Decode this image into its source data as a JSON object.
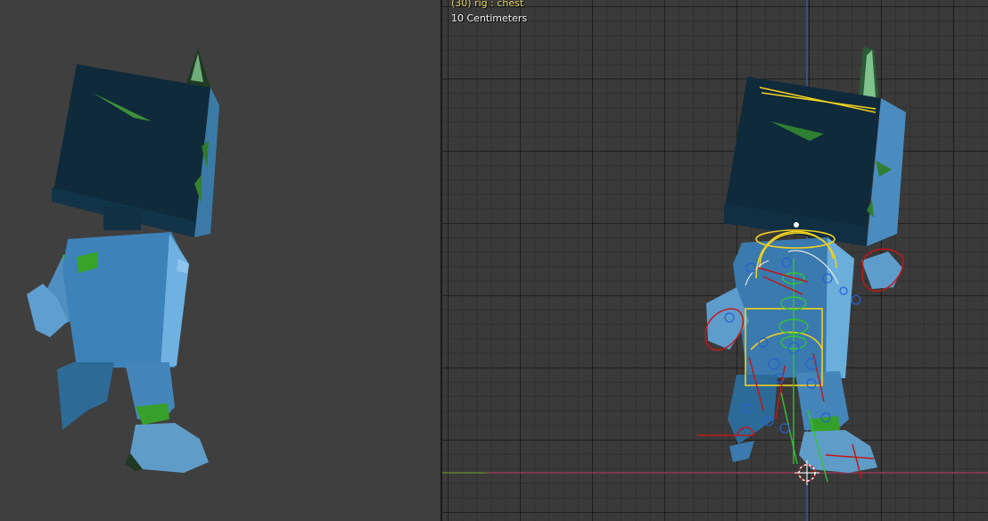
{
  "viewport_right": {
    "active_object_label": "(30) rig : chest",
    "grid_scale_label": "10 Centimeters"
  },
  "colors": {
    "active_object_text": "#e5d55a",
    "grid_scale_text": "#f0f0f0",
    "body_blue": "#3d82b8",
    "head_dark": "#0f2a3b",
    "accent_green": "#3fae2a",
    "bone_selected_yellow": "#f0d020",
    "bone_green": "#33c433",
    "bone_red": "#c01818",
    "bone_blue": "#2a5fd0",
    "x_axis": "#a83a58",
    "y_axis": "#5a8a2a",
    "z_axis": "#3a62b0"
  },
  "icons": [
    "3d-cursor-icon"
  ]
}
